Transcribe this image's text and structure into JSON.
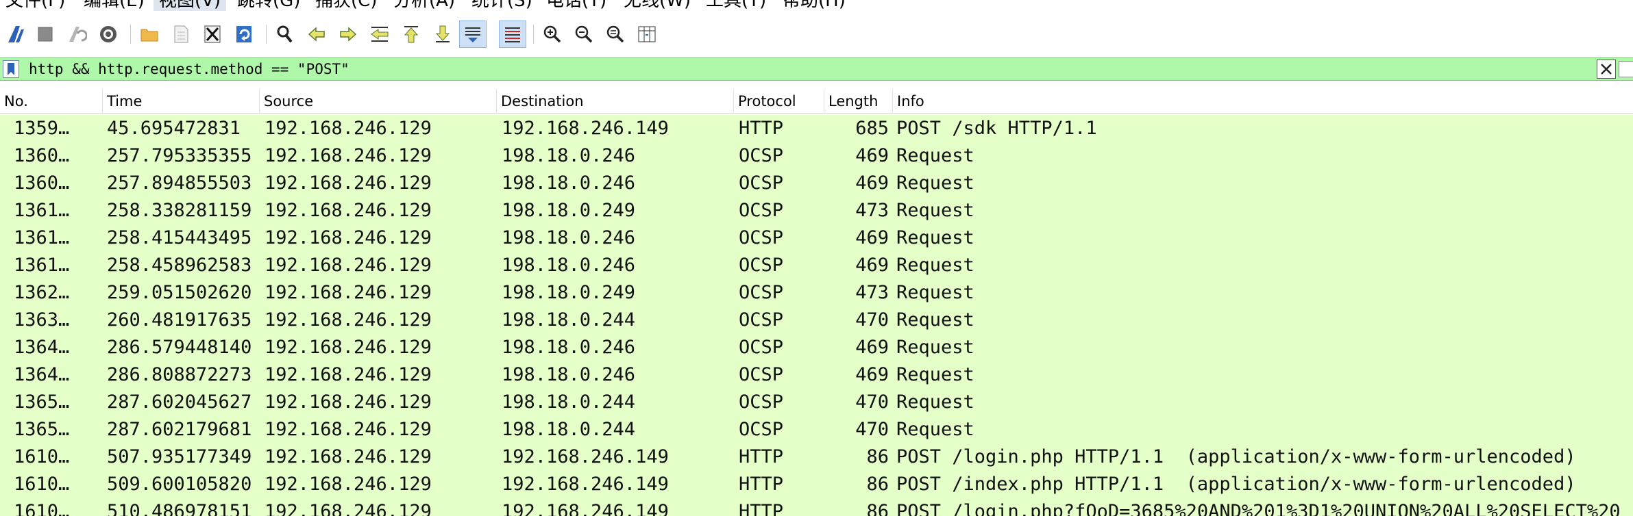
{
  "menu": {
    "items": [
      "文件(F)",
      "编辑(E)",
      "视图(V)",
      "跳转(G)",
      "捕获(C)",
      "分析(A)",
      "统计(S)",
      "电话(Y)",
      "无线(W)",
      "工具(T)",
      "帮助(H)"
    ]
  },
  "toolbar": {
    "icons": [
      "start-capture-icon",
      "stop-capture-icon",
      "restart-capture-icon",
      "capture-options-icon",
      "open-file-icon",
      "save-file-icon",
      "close-file-icon",
      "reload-file-icon",
      "find-packet-icon",
      "go-back-icon",
      "go-forward-icon",
      "go-to-packet-icon",
      "go-first-packet-icon",
      "go-last-packet-icon",
      "auto-scroll-icon",
      "colorize-icon",
      "zoom-in-icon",
      "zoom-out-icon",
      "zoom-normal-icon",
      "resize-columns-icon"
    ]
  },
  "filter": {
    "value": "http && http.request.method == \"POST\""
  },
  "columns": [
    "No.",
    "Time",
    "Source",
    "Destination",
    "Protocol",
    "Length",
    "Info"
  ],
  "packets": [
    {
      "no": "1359…",
      "time": "45.695472831",
      "source": "192.168.246.129",
      "destination": "192.168.246.149",
      "protocol": "HTTP",
      "length": "685",
      "info": "POST /sdk HTTP/1.1"
    },
    {
      "no": "1360…",
      "time": "257.795335355",
      "source": "192.168.246.129",
      "destination": "198.18.0.246",
      "protocol": "OCSP",
      "length": "469",
      "info": "Request"
    },
    {
      "no": "1360…",
      "time": "257.894855503",
      "source": "192.168.246.129",
      "destination": "198.18.0.246",
      "protocol": "OCSP",
      "length": "469",
      "info": "Request"
    },
    {
      "no": "1361…",
      "time": "258.338281159",
      "source": "192.168.246.129",
      "destination": "198.18.0.249",
      "protocol": "OCSP",
      "length": "473",
      "info": "Request"
    },
    {
      "no": "1361…",
      "time": "258.415443495",
      "source": "192.168.246.129",
      "destination": "198.18.0.246",
      "protocol": "OCSP",
      "length": "469",
      "info": "Request"
    },
    {
      "no": "1361…",
      "time": "258.458962583",
      "source": "192.168.246.129",
      "destination": "198.18.0.246",
      "protocol": "OCSP",
      "length": "469",
      "info": "Request"
    },
    {
      "no": "1362…",
      "time": "259.051502620",
      "source": "192.168.246.129",
      "destination": "198.18.0.249",
      "protocol": "OCSP",
      "length": "473",
      "info": "Request"
    },
    {
      "no": "1363…",
      "time": "260.481917635",
      "source": "192.168.246.129",
      "destination": "198.18.0.244",
      "protocol": "OCSP",
      "length": "470",
      "info": "Request"
    },
    {
      "no": "1364…",
      "time": "286.579448140",
      "source": "192.168.246.129",
      "destination": "198.18.0.246",
      "protocol": "OCSP",
      "length": "469",
      "info": "Request"
    },
    {
      "no": "1364…",
      "time": "286.808872273",
      "source": "192.168.246.129",
      "destination": "198.18.0.246",
      "protocol": "OCSP",
      "length": "469",
      "info": "Request"
    },
    {
      "no": "1365…",
      "time": "287.602045627",
      "source": "192.168.246.129",
      "destination": "198.18.0.244",
      "protocol": "OCSP",
      "length": "470",
      "info": "Request"
    },
    {
      "no": "1365…",
      "time": "287.602179681",
      "source": "192.168.246.129",
      "destination": "198.18.0.244",
      "protocol": "OCSP",
      "length": "470",
      "info": "Request"
    },
    {
      "no": "1610…",
      "time": "507.935177349",
      "source": "192.168.246.129",
      "destination": "192.168.246.149",
      "protocol": "HTTP",
      "length": "86",
      "info": "POST /login.php HTTP/1.1  (application/x-www-form-urlencoded)"
    },
    {
      "no": "1610…",
      "time": "509.600105820",
      "source": "192.168.246.129",
      "destination": "192.168.246.149",
      "protocol": "HTTP",
      "length": "86",
      "info": "POST /index.php HTTP/1.1  (application/x-www-form-urlencoded)"
    },
    {
      "no": "1610…",
      "time": "510.486978151",
      "source": "192.168.246.129",
      "destination": "192.168.246.149",
      "protocol": "HTTP",
      "length": "86",
      "info": "POST /login.php?fOoD=3685%20AND%201%3D1%20UNION%20ALL%20SELECT%20"
    }
  ],
  "colors": {
    "row_background": "#e4ffc7",
    "filter_background": "#aff7a9"
  }
}
